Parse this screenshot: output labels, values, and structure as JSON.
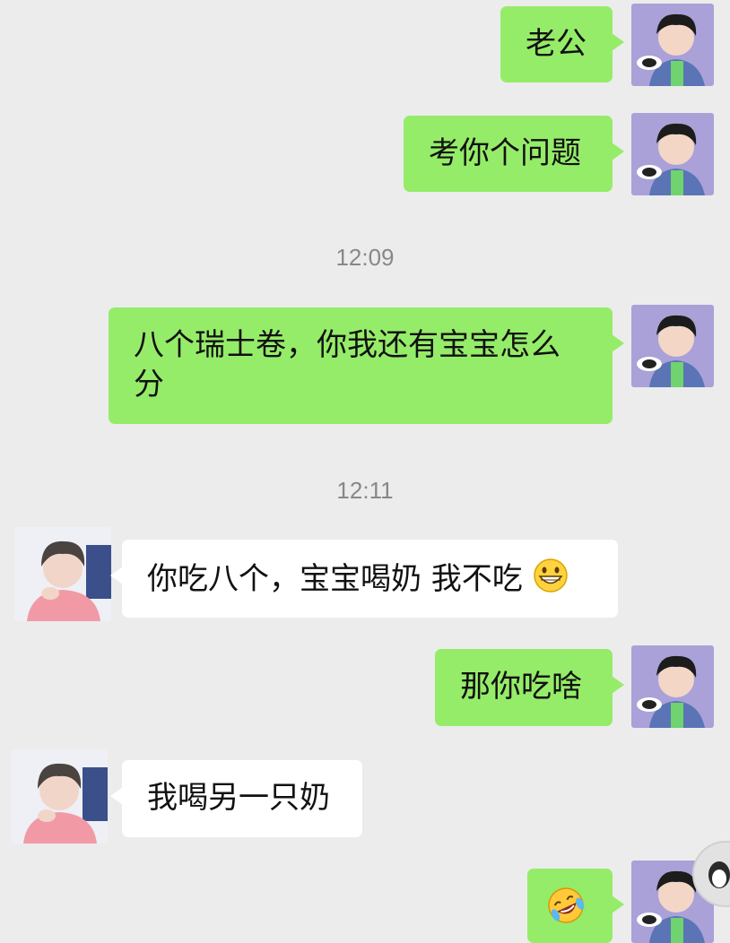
{
  "messages": [
    {
      "id": "m1",
      "sender": "me",
      "text": "老公"
    },
    {
      "id": "m2",
      "sender": "me",
      "text": "考你个问题"
    },
    {
      "id": "m3",
      "sender": "me",
      "text": "八个瑞士卷，你我还有宝宝怎么分"
    },
    {
      "id": "m4",
      "sender": "them",
      "text": "你吃八个，宝宝喝奶  我不吃",
      "emoji": "grinning-face"
    },
    {
      "id": "m5",
      "sender": "me",
      "text": "那你吃啥"
    },
    {
      "id": "m6",
      "sender": "them",
      "text": "我喝另一只奶"
    },
    {
      "id": "m7",
      "sender": "me",
      "emoji": "rolling-on-the-floor-laughing"
    }
  ],
  "timestamps": [
    "12:09",
    "12:11"
  ],
  "colors": {
    "me_bubble": "#95ec69",
    "them_bubble": "#ffffff",
    "background": "#ececec",
    "timestamp": "#888888"
  }
}
